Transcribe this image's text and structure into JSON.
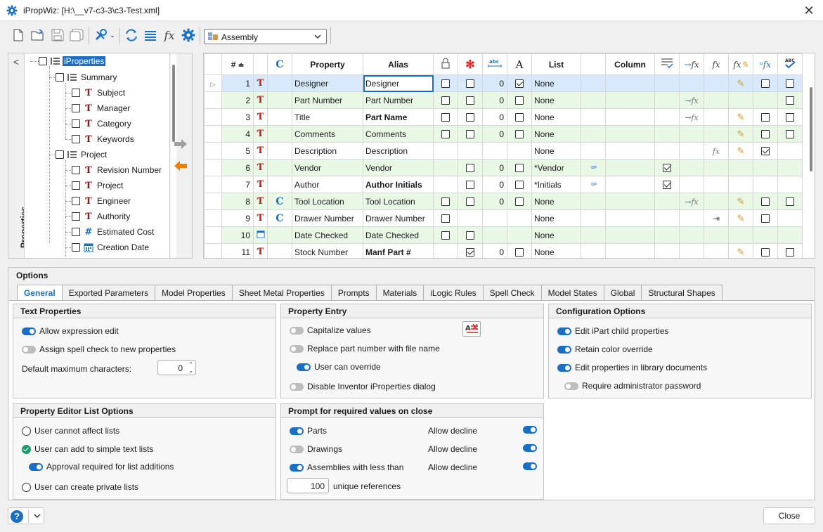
{
  "window": {
    "title": "iPropWiz: [H:\\__v7-c3-3\\c3-Test.xml]",
    "close_glyph": "✕"
  },
  "toolbar": {
    "document_type": "Assembly"
  },
  "tree": {
    "side_label": "Properties",
    "root": "iProperties",
    "groups": [
      {
        "label": "Summary",
        "items": [
          {
            "label": "Subject",
            "icon": "text-property-icon"
          },
          {
            "label": "Manager",
            "icon": "text-property-icon"
          },
          {
            "label": "Category",
            "icon": "text-property-icon"
          },
          {
            "label": "Keywords",
            "icon": "text-property-icon"
          }
        ]
      },
      {
        "label": "Project",
        "items": [
          {
            "label": "Revision Number",
            "icon": "text-property-icon"
          },
          {
            "label": "Project",
            "icon": "text-property-icon"
          },
          {
            "label": "Engineer",
            "icon": "text-property-icon"
          },
          {
            "label": "Authority",
            "icon": "text-property-icon"
          },
          {
            "label": "Estimated Cost",
            "icon": "number-property-icon"
          },
          {
            "label": "Creation Date",
            "icon": "date-property-icon"
          }
        ]
      }
    ]
  },
  "grid": {
    "headers": {
      "num": "#",
      "c": "C",
      "property": "Property",
      "alias": "Alias",
      "lock": "",
      "required": "",
      "maxchars": "",
      "font": "A",
      "list": "List",
      "column": "Column"
    },
    "rows": [
      {
        "n": "1",
        "type": "T",
        "c": "",
        "property": "Designer",
        "alias": "Designer",
        "alias_bold": false,
        "lock": false,
        "req": false,
        "max": "0",
        "font": true,
        "list": "None"
      },
      {
        "n": "2",
        "type": "T",
        "c": "",
        "property": "Part Number",
        "alias": "Part Number",
        "alias_bold": false,
        "lock": false,
        "req": false,
        "max": "0",
        "font": false,
        "list": "None"
      },
      {
        "n": "3",
        "type": "T",
        "c": "",
        "property": "Title",
        "alias": "Part Name",
        "alias_bold": true,
        "lock": false,
        "req": false,
        "max": "0",
        "font": false,
        "list": "None"
      },
      {
        "n": "4",
        "type": "T",
        "c": "",
        "property": "Comments",
        "alias": "Comments",
        "alias_bold": false,
        "lock": false,
        "req": false,
        "max": "0",
        "font": false,
        "list": "None"
      },
      {
        "n": "5",
        "type": "T",
        "c": "",
        "property": "Description",
        "alias": "Description",
        "alias_bold": false,
        "list": "None"
      },
      {
        "n": "6",
        "type": "T",
        "c": "",
        "property": "Vendor",
        "alias": "Vendor",
        "alias_bold": false,
        "req": false,
        "max": "0",
        "font": false,
        "list": "*Vendor"
      },
      {
        "n": "7",
        "type": "T",
        "c": "",
        "property": "Author",
        "alias": "Author Initials",
        "alias_bold": true,
        "req": false,
        "max": "0",
        "font": false,
        "list": "*Initials"
      },
      {
        "n": "8",
        "type": "T",
        "c": "C",
        "property": "Tool Location",
        "alias": "Tool Location",
        "alias_bold": false,
        "lock": false,
        "req": false,
        "max": "0",
        "font": false,
        "list": "None"
      },
      {
        "n": "9",
        "type": "T",
        "c": "C",
        "property": "Drawer Number",
        "alias": "Drawer Number",
        "alias_bold": false,
        "lock": false,
        "list": "None"
      },
      {
        "n": "10",
        "type": "D",
        "c": "",
        "property": "Date Checked",
        "alias": "Date Checked",
        "alias_bold": false,
        "lock": false,
        "req": false,
        "list": "None"
      },
      {
        "n": "11",
        "type": "T",
        "c": "",
        "property": "Stock Number",
        "alias": "Manf Part #",
        "alias_bold": true,
        "req": true,
        "max": "0",
        "font": false,
        "list": "None"
      }
    ]
  },
  "options": {
    "title": "Options",
    "tabs": [
      "General",
      "Exported Parameters",
      "Model Properties",
      "Sheet Metal Properties",
      "Prompts",
      "Materials",
      "iLogic Rules",
      "Spell Check",
      "Model States",
      "Global",
      "Structural Shapes"
    ],
    "text_properties": {
      "title": "Text Properties",
      "allow_expression_edit": "Allow expression edit",
      "assign_spell_check": "Assign spell check to new properties",
      "default_max_chars_label": "Default maximum characters:",
      "default_max_chars": "0"
    },
    "property_entry": {
      "title": "Property Entry",
      "capitalize": "Capitalize values",
      "replace_part_number": "Replace part number with file name",
      "user_can_override": "User can override",
      "disable_dialog": "Disable Inventor iProperties dialog"
    },
    "configuration": {
      "title": "Configuration Options",
      "edit_ipart": "Edit iPart child properties",
      "retain_color": "Retain color override",
      "edit_library": "Edit properties in library documents",
      "require_admin": "Require administrator password"
    },
    "list_options": {
      "title": "Property Editor List Options",
      "cannot_affect": "User cannot affect lists",
      "can_add": "User can add to simple text lists",
      "approval": "Approval required for list additions",
      "private_lists": "User can create private lists"
    },
    "prompt_required": {
      "title": "Prompt for required values on close",
      "parts": "Parts",
      "drawings": "Drawings",
      "assemblies": "Assemblies with less than",
      "allow_decline": "Allow decline",
      "unique_refs_value": "100",
      "unique_refs_label": "unique references"
    }
  },
  "footer": {
    "help": "?",
    "close": "Close"
  },
  "colors": {
    "accent": "#1a6fc4",
    "alt_row": "#e8f8e5",
    "selected_row": "#d7e9fa",
    "pencil": "#e39a1a",
    "arrow_active": "#ee7d00"
  }
}
